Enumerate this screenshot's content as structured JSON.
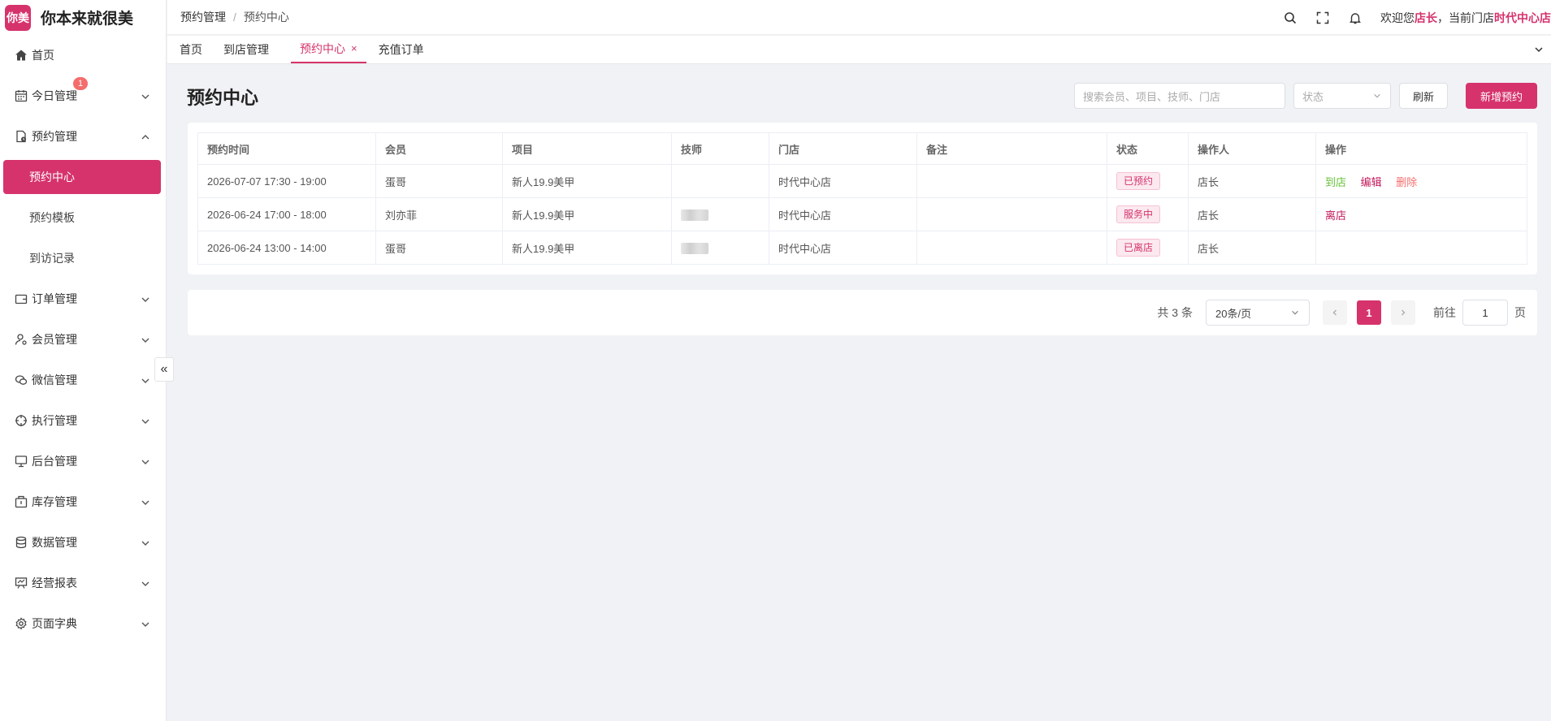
{
  "app": {
    "logo_text": "你美",
    "name": "你本来就很美"
  },
  "sidebar": {
    "items": [
      {
        "label": "首页",
        "icon": "home-icon"
      },
      {
        "label": "今日管理",
        "icon": "calendar-icon",
        "badge": "1"
      },
      {
        "label": "预约管理",
        "icon": "clipboard-icon",
        "expanded": true,
        "children": [
          {
            "label": "预约中心",
            "active": true
          },
          {
            "label": "预约模板"
          },
          {
            "label": "到访记录"
          }
        ]
      },
      {
        "label": "订单管理",
        "icon": "wallet-icon"
      },
      {
        "label": "会员管理",
        "icon": "user-icon"
      },
      {
        "label": "微信管理",
        "icon": "chat-icon"
      },
      {
        "label": "执行管理",
        "icon": "target-icon"
      },
      {
        "label": "后台管理",
        "icon": "monitor-icon"
      },
      {
        "label": "库存管理",
        "icon": "box-icon"
      },
      {
        "label": "数据管理",
        "icon": "database-icon"
      },
      {
        "label": "经营报表",
        "icon": "chart-board-icon"
      },
      {
        "label": "页面字典",
        "icon": "gear-icon"
      }
    ],
    "collapse_symbol": "«"
  },
  "header": {
    "breadcrumb": [
      "预约管理",
      "预约中心"
    ],
    "breadcrumb_sep": "/",
    "welcome_prefix": "欢迎您",
    "user": "店长",
    "welcome_mid": "，当前门店",
    "store": "时代中心店"
  },
  "tabs": [
    {
      "label": "首页"
    },
    {
      "label": "到店管理"
    },
    {
      "label": "预约中心",
      "active": true,
      "close": "×"
    },
    {
      "label": "充值订单"
    }
  ],
  "main": {
    "title": "预约中心",
    "search_placeholder": "搜索会员、项目、技师、门店",
    "status_placeholder": "状态",
    "refresh_label": "刷新",
    "add_label": "新增预约"
  },
  "table": {
    "columns": [
      "预约时间",
      "会员",
      "项目",
      "技师",
      "门店",
      "备注",
      "状态",
      "操作人",
      "操作"
    ],
    "rows": [
      {
        "time": "2026-07-07 17:30 - 19:00",
        "member": "蛋哥",
        "project": "新人19.9美甲",
        "tech": "",
        "store": "时代中心店",
        "note": "",
        "status": "已预约",
        "operator": "店长",
        "actions": [
          {
            "label": "到店",
            "color": "#67c23a"
          },
          {
            "label": "编辑",
            "color": "#c2185b"
          },
          {
            "label": "删除",
            "color": "#f56c6c"
          }
        ]
      },
      {
        "time": "2026-06-24 17:00 - 18:00",
        "member": "刘亦菲",
        "project": "新人19.9美甲",
        "tech": "blurred",
        "store": "时代中心店",
        "note": "",
        "status": "服务中",
        "operator": "店长",
        "actions": [
          {
            "label": "离店",
            "color": "#c2185b"
          }
        ]
      },
      {
        "time": "2026-06-24 13:00 - 14:00",
        "member": "蛋哥",
        "project": "新人19.9美甲",
        "tech": "blurred",
        "store": "时代中心店",
        "note": "",
        "status": "已离店",
        "operator": "店长",
        "actions": []
      }
    ]
  },
  "pagination": {
    "total_text": "共 3 条",
    "page_size": "20条/页",
    "current_page": "1",
    "goto_prefix": "前往",
    "goto_value": "1",
    "goto_suffix": "页"
  },
  "colors": {
    "accent": "#d6336c"
  }
}
